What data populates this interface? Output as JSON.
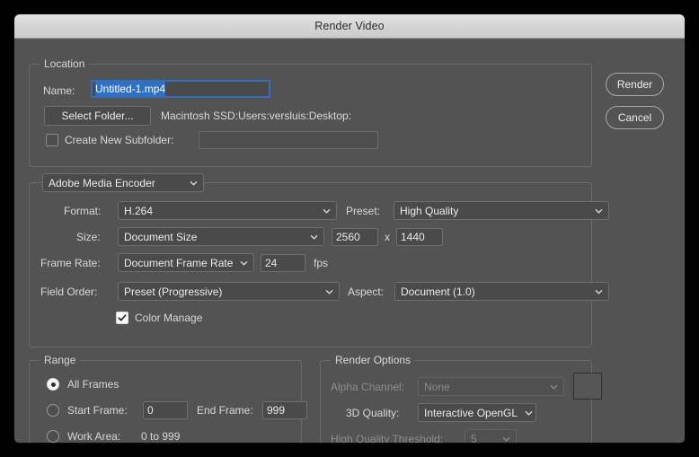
{
  "window": {
    "title": "Render Video"
  },
  "actions": {
    "render_label": "Render",
    "cancel_label": "Cancel"
  },
  "location": {
    "legend": "Location",
    "name_label": "Name:",
    "name_value": "Untitled-1.mp4",
    "select_folder_label": "Select Folder...",
    "path_value": "Macintosh SSD:Users:versluis:Desktop:",
    "create_subfolder_label": "Create New Subfolder:",
    "create_subfolder_checked": false,
    "subfolder_value": ""
  },
  "encoder": {
    "engine_value": "Adobe Media Encoder",
    "format_label": "Format:",
    "format_value": "H.264",
    "preset_label": "Preset:",
    "preset_value": "High Quality",
    "size_label": "Size:",
    "size_value": "Document Size",
    "width_value": "2560",
    "times_label": "x",
    "height_value": "1440",
    "frame_rate_label": "Frame Rate:",
    "frame_rate_value": "Document Frame Rate",
    "fps_value": "24",
    "fps_label": "fps",
    "field_order_label": "Field Order:",
    "field_order_value": "Preset (Progressive)",
    "aspect_label": "Aspect:",
    "aspect_value": "Document (1.0)",
    "color_manage_label": "Color Manage",
    "color_manage_checked": true
  },
  "range": {
    "legend": "Range",
    "all_frames_label": "All Frames",
    "start_frame_label": "Start Frame:",
    "start_frame_value": "0",
    "end_frame_label": "End Frame:",
    "end_frame_value": "999",
    "work_area_label": "Work Area:",
    "work_area_value": "0 to 999",
    "selected": "all_frames"
  },
  "render_options": {
    "legend": "Render Options",
    "alpha_channel_label": "Alpha Channel:",
    "alpha_channel_value": "None",
    "alpha_channel_disabled": true,
    "quality_3d_label": "3D Quality:",
    "quality_3d_value": "Interactive OpenGL",
    "hq_threshold_label": "High Quality Threshold:",
    "hq_threshold_value": "5",
    "hq_threshold_disabled": true
  },
  "colors": {
    "dialog_bg": "#535353",
    "accent_selection": "#2f6fc4",
    "titlebar_top": "#e4e4e4",
    "field_bg": "#4a4a4a"
  }
}
